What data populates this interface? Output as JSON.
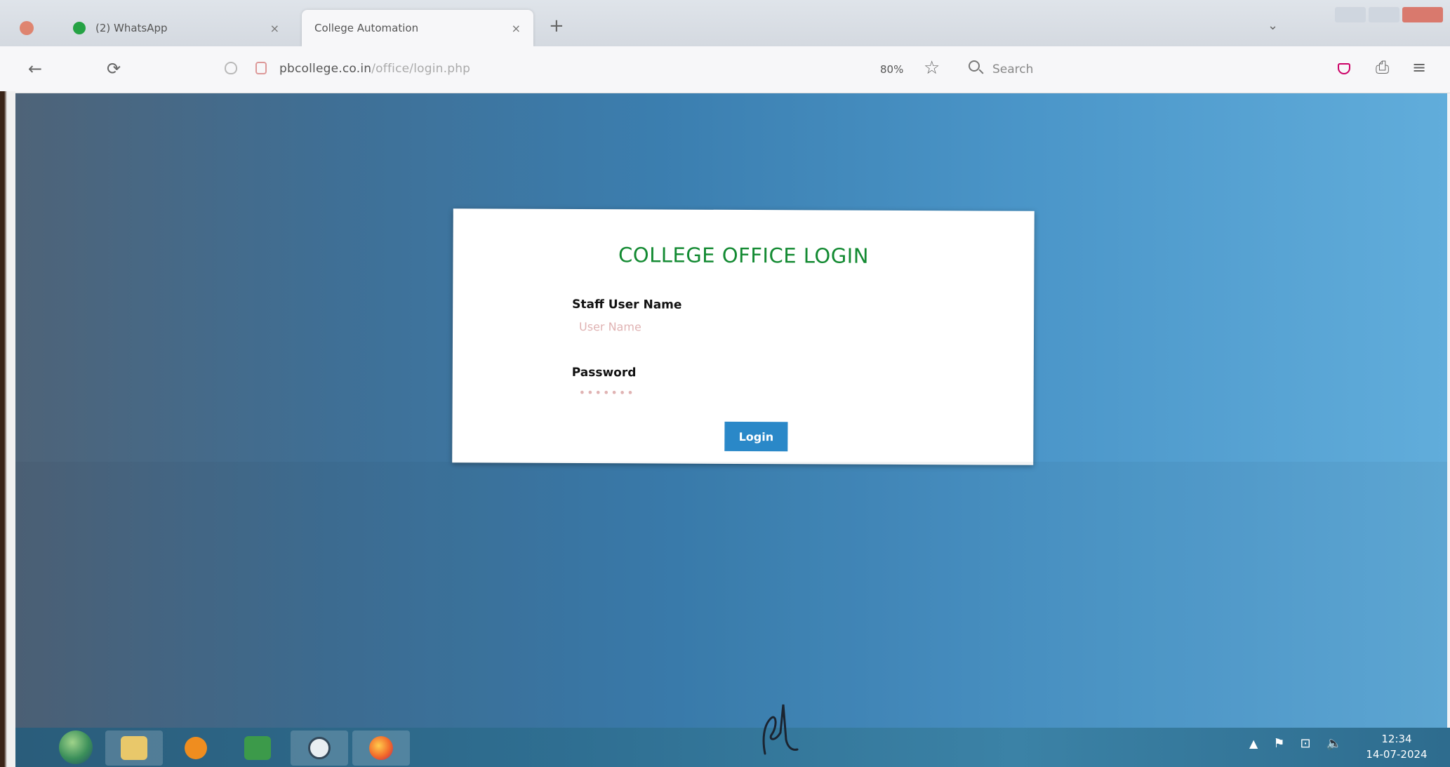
{
  "browser": {
    "tabs": [
      {
        "label": "(2) WhatsApp",
        "active": false
      },
      {
        "label": "College Automation",
        "active": true
      }
    ],
    "new_tab": "+",
    "tab_list": "⌄",
    "close_glyph": "×",
    "nav": {
      "back": "←",
      "reload": "⟳",
      "url_domain": "pbcollege.co.in",
      "url_path": "/office/login.php",
      "zoom": "80%",
      "bookmark": "☆",
      "search_placeholder": "Search",
      "extensions": "⎙",
      "menu": "≡"
    }
  },
  "login": {
    "title": "COLLEGE OFFICE LOGIN",
    "username_label": "Staff User Name",
    "username_placeholder": "User Name",
    "password_label": "Password",
    "password_placeholder": "•••••••",
    "button_label": "Login",
    "title_color": "#138a32",
    "button_color": "#2a88c8"
  },
  "taskbar": {
    "tray_arrow": "▲",
    "tray_flag": "⚑",
    "tray_network": "⊡",
    "tray_volume": "🔈",
    "time": "12:34",
    "date": "14-07-2024"
  }
}
